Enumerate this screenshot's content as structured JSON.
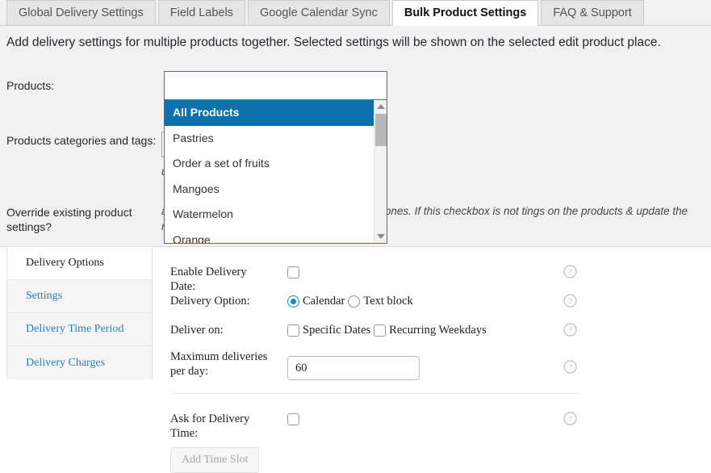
{
  "tabs": [
    {
      "label": "Global Delivery Settings",
      "active": false
    },
    {
      "label": "Field Labels",
      "active": false
    },
    {
      "label": "Google Calendar Sync",
      "active": false
    },
    {
      "label": "Bulk Product Settings",
      "active": true
    },
    {
      "label": "FAQ & Support",
      "active": false
    }
  ],
  "intro": "Add delivery settings for multiple products together. Selected settings will be shown on the selected edit product place.",
  "form": {
    "products_label": "Products:",
    "categories_label": "Products categories and tags:",
    "categories_hint": "ulk settings",
    "override_label": "Override existing product settings?",
    "override_hint": "ace the existing delivery settings with the new ones. If this checkbox is not tings on the products & update the new ones in it."
  },
  "dropdown": {
    "search_value": "",
    "search_placeholder": "",
    "options": [
      {
        "label": "All Products",
        "selected": true
      },
      {
        "label": "Pastries",
        "selected": false
      },
      {
        "label": "Order a set of fruits",
        "selected": false
      },
      {
        "label": "Mangoes",
        "selected": false
      },
      {
        "label": "Watermelon",
        "selected": false
      },
      {
        "label": "Orange",
        "selected": false
      }
    ]
  },
  "vertical_tabs": [
    {
      "label": "Delivery Options",
      "active": true
    },
    {
      "label": "Settings",
      "active": false
    },
    {
      "label": "Delivery Time Period",
      "active": false
    },
    {
      "label": "Delivery Charges",
      "active": false
    }
  ],
  "settings": {
    "enable_delivery_date_label": "Enable Delivery Date:",
    "delivery_option_label": "Delivery Option:",
    "delivery_option_calendar": "Calendar",
    "delivery_option_text_block": "Text block",
    "deliver_on_label": "Deliver on:",
    "deliver_on_specific_dates": "Specific Dates",
    "deliver_on_recurring_weekdays": "Recurring Weekdays",
    "max_deliveries_label": "Maximum deliveries per day:",
    "max_deliveries_value": "60",
    "ask_delivery_time_label": "Ask for Delivery Time:",
    "add_time_slot_label": "Add Time Slot"
  },
  "colors": {
    "accent_blue": "#0d72ab",
    "radio_blue": "#1b86c0",
    "link_blue": "#2a7fbb",
    "page_gray": "#f1f1f1"
  },
  "icons": {
    "help": "help-circle-icon",
    "scroll_up": "chevron-up-icon",
    "scroll_down": "chevron-down-icon"
  }
}
